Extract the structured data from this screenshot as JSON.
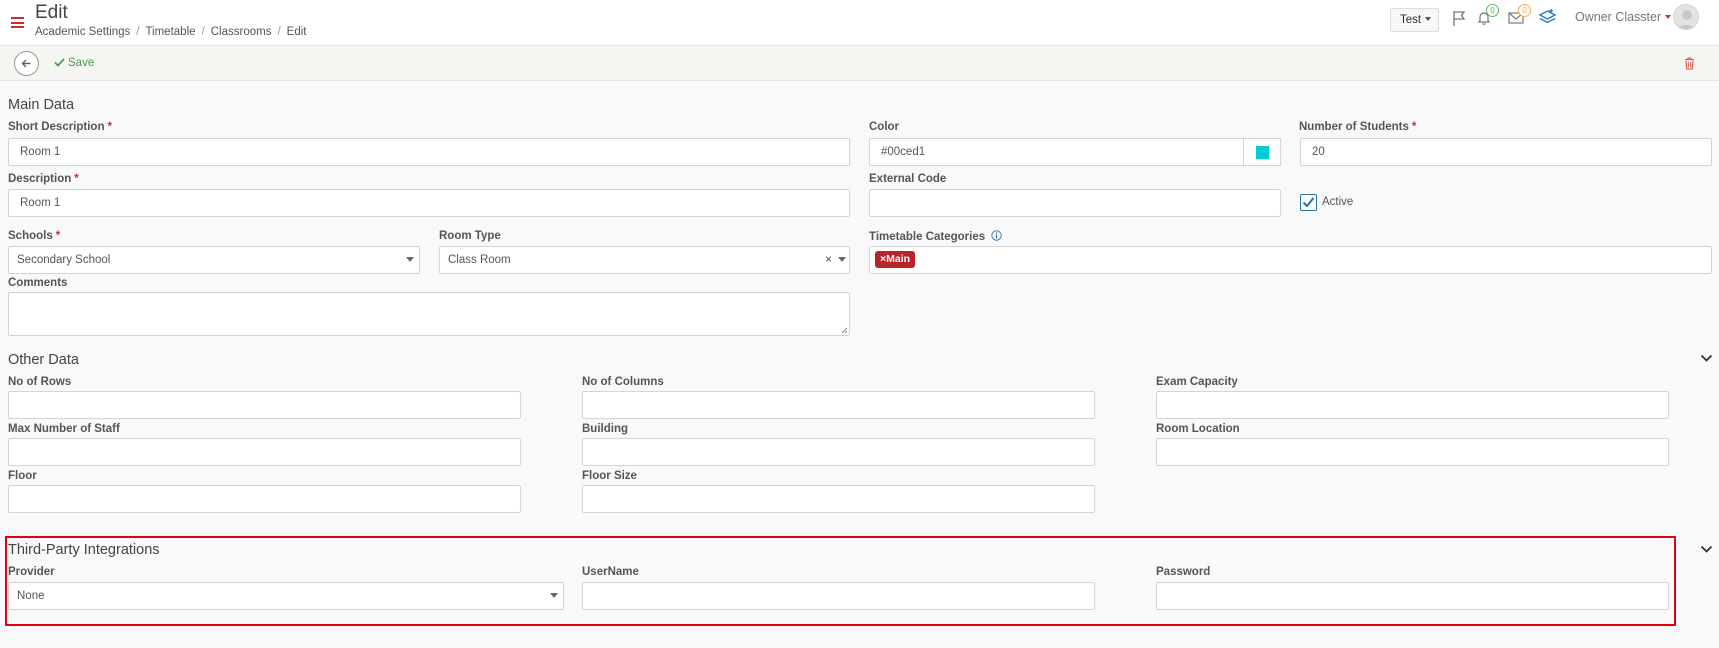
{
  "header": {
    "title": "Edit",
    "breadcrumb": [
      "Academic Settings",
      "Timetable",
      "Classrooms",
      "Edit"
    ],
    "tenant_label": "Test",
    "notifications_count": "0",
    "messages_count": "0",
    "user_name": "Owner Classter"
  },
  "toolbar": {
    "save_label": "Save"
  },
  "main_data": {
    "title": "Main Data",
    "short_description": {
      "label": "Short Description",
      "value": "Room 1"
    },
    "description": {
      "label": "Description",
      "value": "Room 1"
    },
    "color": {
      "label": "Color",
      "value": "#00ced1",
      "swatch": "#00ced1"
    },
    "external_code": {
      "label": "External Code",
      "value": ""
    },
    "number_of_students": {
      "label": "Number of Students",
      "value": "20"
    },
    "active": {
      "label": "Active",
      "checked": true
    },
    "schools": {
      "label": "Schools",
      "value": "Secondary School"
    },
    "room_type": {
      "label": "Room Type",
      "value": "Class Room"
    },
    "timetable_categories": {
      "label": "Timetable Categories",
      "tags": [
        "Main"
      ]
    },
    "comments": {
      "label": "Comments",
      "value": ""
    }
  },
  "other_data": {
    "title": "Other Data",
    "fields": {
      "no_of_rows": "No of Rows",
      "no_of_columns": "No of Columns",
      "exam_capacity": "Exam Capacity",
      "max_number_of_staff": "Max Number of Staff",
      "building": "Building",
      "room_location": "Room Location",
      "floor": "Floor",
      "floor_size": "Floor Size"
    }
  },
  "third_party": {
    "title": "Third-Party Integrations",
    "provider": {
      "label": "Provider",
      "value": "None"
    },
    "username": {
      "label": "UserName",
      "value": ""
    },
    "password": {
      "label": "Password",
      "value": ""
    }
  },
  "colors": {
    "accent_red": "#c9302c",
    "highlight_border": "#e3000f",
    "tag_bg": "#b7242a",
    "save_green": "#4a9a4a"
  }
}
